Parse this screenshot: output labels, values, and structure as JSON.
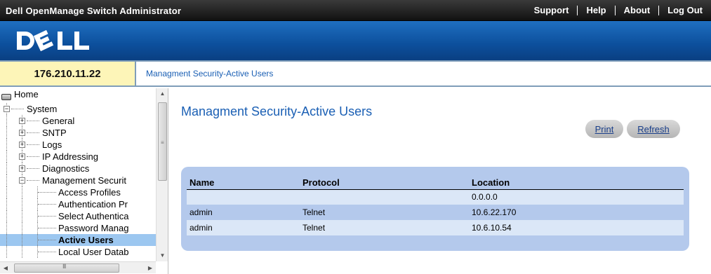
{
  "header": {
    "app_title": "Dell OpenManage Switch Administrator",
    "links": [
      "Support",
      "Help",
      "About",
      "Log Out"
    ],
    "logo_text": "DELL"
  },
  "infobar": {
    "ip": "176.210.11.22",
    "breadcrumb": "Managment Security-Active Users"
  },
  "nav": {
    "items": [
      {
        "label": "Home"
      },
      {
        "label": "System"
      },
      {
        "label": "General"
      },
      {
        "label": "SNTP"
      },
      {
        "label": "Logs"
      },
      {
        "label": "IP Addressing"
      },
      {
        "label": "Diagnostics"
      },
      {
        "label": "Management Securit"
      },
      {
        "label": "Access Profiles"
      },
      {
        "label": "Authentication Pr"
      },
      {
        "label": "Select Authentica"
      },
      {
        "label": "Password Manag"
      },
      {
        "label": "Active Users"
      },
      {
        "label": "Local User Datab"
      }
    ],
    "active": "Active Users"
  },
  "main": {
    "title": "Managment Security-Active Users",
    "buttons": {
      "print": "Print",
      "refresh": "Refresh"
    },
    "table": {
      "headers": [
        "Name",
        "Protocol",
        "Location"
      ],
      "rows": [
        [
          "",
          "",
          "0.0.0.0"
        ],
        [
          "admin",
          "Telnet",
          "10.6.22.170"
        ],
        [
          "admin",
          "Telnet",
          "10.6.10.54"
        ]
      ]
    }
  },
  "colors": {
    "accent": "#1a5fb4",
    "brand_band": "#0c4f9c",
    "panel": "#b4c9ec",
    "ip_box": "#fdf5b8",
    "active_nav": "#9cc7f0"
  }
}
